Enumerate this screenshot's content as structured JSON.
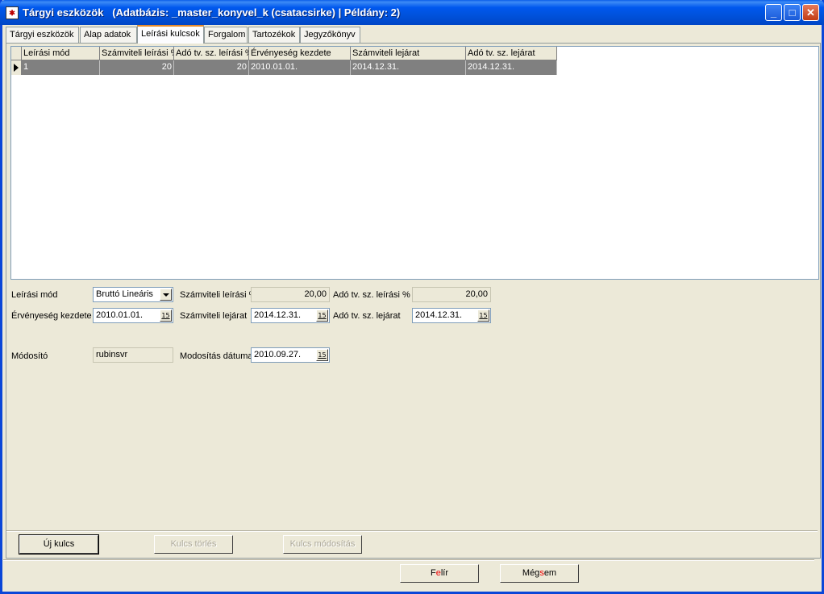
{
  "window": {
    "title": "Tárgyi eszközök   (Adatbázis: _master_konyvel_k (csatacsirke) | Példány: 2)",
    "icon": "app-icon"
  },
  "tabs": [
    {
      "label": "Tárgyi eszközök"
    },
    {
      "label": "Alap adatok"
    },
    {
      "label": "Leírási kulcsok",
      "active": true
    },
    {
      "label": "Forgalom"
    },
    {
      "label": "Tartozékok"
    },
    {
      "label": "Jegyzőkönyv"
    }
  ],
  "grid": {
    "columns": [
      "Leírási mód",
      "Számviteli leírási %",
      "Adó tv. sz. leírási %",
      "Érvényeség kezdete",
      "Számviteli lejárat",
      "Adó tv. sz. lejárat"
    ],
    "rows": [
      [
        "1",
        "20",
        "20",
        "2010.01.01.",
        "2014.12.31.",
        "2014.12.31."
      ]
    ]
  },
  "form": {
    "leirasi_mod_label": "Leírási mód",
    "leirasi_mod_value": "Bruttó Lineáris",
    "szamv_leirasi_label": "Számviteli leírási %",
    "szamv_leirasi_value": "20,00",
    "ado_leirasi_label": "Adó tv. sz. leírási %",
    "ado_leirasi_value": "20,00",
    "ervenyesseg_label": "Érvényeség kezdete",
    "ervenyesseg_value": "2010.01.01.",
    "szamv_lejarat_label": "Számviteli lejárat",
    "szamv_lejarat_value": "2014.12.31.",
    "ado_lejarat_label": "Adó tv. sz. lejárat",
    "ado_lejarat_value": "2014.12.31.",
    "modosito_label": "Módosító",
    "modosito_value": "rubinsvr",
    "modositas_datuma_label": "Modosítás dátuma",
    "modositas_datuma_value": "2010.09.27.",
    "date_button_glyph": "15"
  },
  "actions": {
    "uj_kulcs": "Új kulcs",
    "kulcs_torles": "Kulcs törlés",
    "kulcs_modositas": "Kulcs módosítás"
  },
  "footer": {
    "felir_a": "F",
    "felir_b": "e",
    "felir_c": "lír",
    "megsem_a": "Még",
    "megsem_b": "s",
    "megsem_c": "em"
  }
}
